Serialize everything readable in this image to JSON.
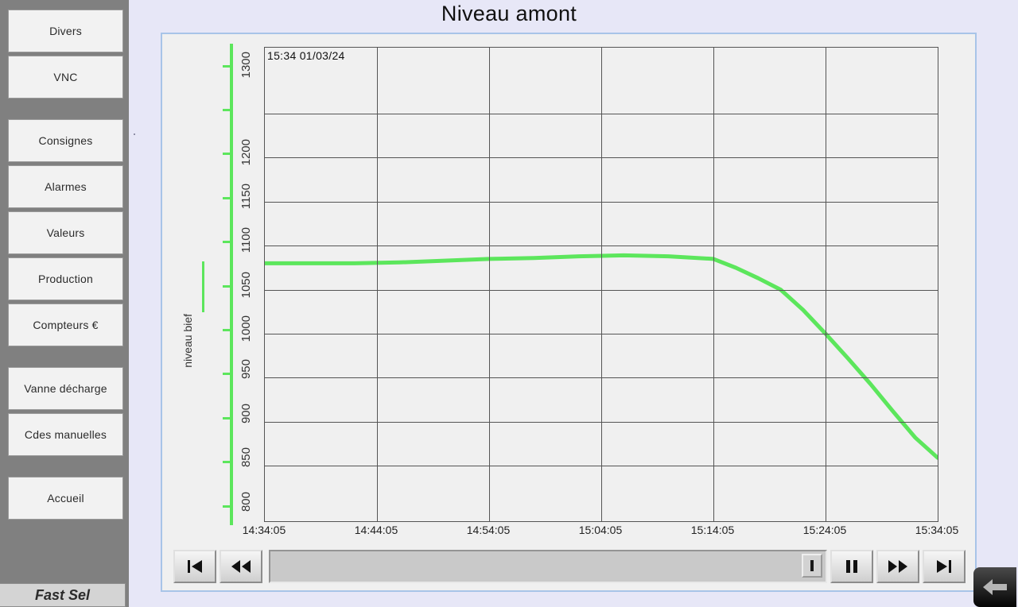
{
  "title": "Niveau amont",
  "colors": {
    "trace": "#5ce65c",
    "page_bg": "#e7e7f7",
    "panel_bg": "#f0f0f0",
    "panel_border": "#a8c4e8",
    "sidebar_bg": "#808080",
    "button_bg": "#f2f2f2"
  },
  "sidebar": {
    "groups": [
      {
        "items": [
          {
            "label": "Divers"
          },
          {
            "label": "VNC"
          }
        ]
      },
      {
        "items": [
          {
            "label": "Consignes"
          },
          {
            "label": "Alarmes"
          },
          {
            "label": "Valeurs"
          },
          {
            "label": "Production"
          },
          {
            "label": "Compteurs €"
          }
        ]
      },
      {
        "items": [
          {
            "label": "Vanne décharge"
          },
          {
            "label": "Cdes manuelles"
          }
        ]
      },
      {
        "items": [
          {
            "label": "Accueil"
          }
        ]
      }
    ],
    "fast_sel": "Fast Sel"
  },
  "chart_data": {
    "type": "line",
    "title": "Niveau amont",
    "timestamp": "15:34  01/03/24",
    "xlabel": "",
    "ylabel": "niveau bief",
    "legend": [
      {
        "name": "niveau bief",
        "color": "#5ce65c"
      }
    ],
    "legend_position": "left-vertical",
    "grid": true,
    "ylim": [
      787,
      1325
    ],
    "yticks": [
      800,
      850,
      900,
      950,
      1000,
      1050,
      1100,
      1150,
      1200,
      1250,
      1300
    ],
    "ytick_labels": [
      "800",
      "850",
      "900",
      "950",
      "1000",
      "1050",
      "1100",
      "1150",
      "1200",
      "",
      "1300"
    ],
    "ygridlines": [
      850,
      900,
      950,
      1000,
      1050,
      1100,
      1150,
      1200,
      1250
    ],
    "xticks": [
      "14:34:05",
      "14:44:05",
      "14:54:05",
      "15:04:05",
      "15:14:05",
      "15:24:05",
      "15:34:05"
    ],
    "xlim": [
      "14:34:05",
      "15:34:05"
    ],
    "series": [
      {
        "name": "niveau bief",
        "color": "#5ce65c",
        "x": [
          "14:34:05",
          "14:38:05",
          "14:42:05",
          "14:46:05",
          "14:50:05",
          "14:54:05",
          "14:58:05",
          "15:02:05",
          "15:06:05",
          "15:10:05",
          "15:14:05",
          "15:16:05",
          "15:18:05",
          "15:20:05",
          "15:22:05",
          "15:24:05",
          "15:26:05",
          "15:28:05",
          "15:30:05",
          "15:32:05",
          "15:34:05"
        ],
        "values": [
          1080,
          1080,
          1080,
          1081,
          1083,
          1085,
          1086,
          1088,
          1089,
          1088,
          1085,
          1075,
          1063,
          1050,
          1027,
          1000,
          972,
          943,
          912,
          882,
          859
        ]
      }
    ]
  },
  "playback": {
    "controls": [
      {
        "name": "skip-to-start",
        "icon": "skip-back-icon"
      },
      {
        "name": "rewind",
        "icon": "rewind-icon"
      },
      {
        "name": "pause",
        "icon": "pause-icon"
      },
      {
        "name": "fast-forward",
        "icon": "fast-forward-icon"
      },
      {
        "name": "skip-to-end",
        "icon": "skip-forward-icon"
      }
    ],
    "scrollbar_thumb_position": "end"
  },
  "back_button": {
    "icon": "arrow-left-icon"
  }
}
